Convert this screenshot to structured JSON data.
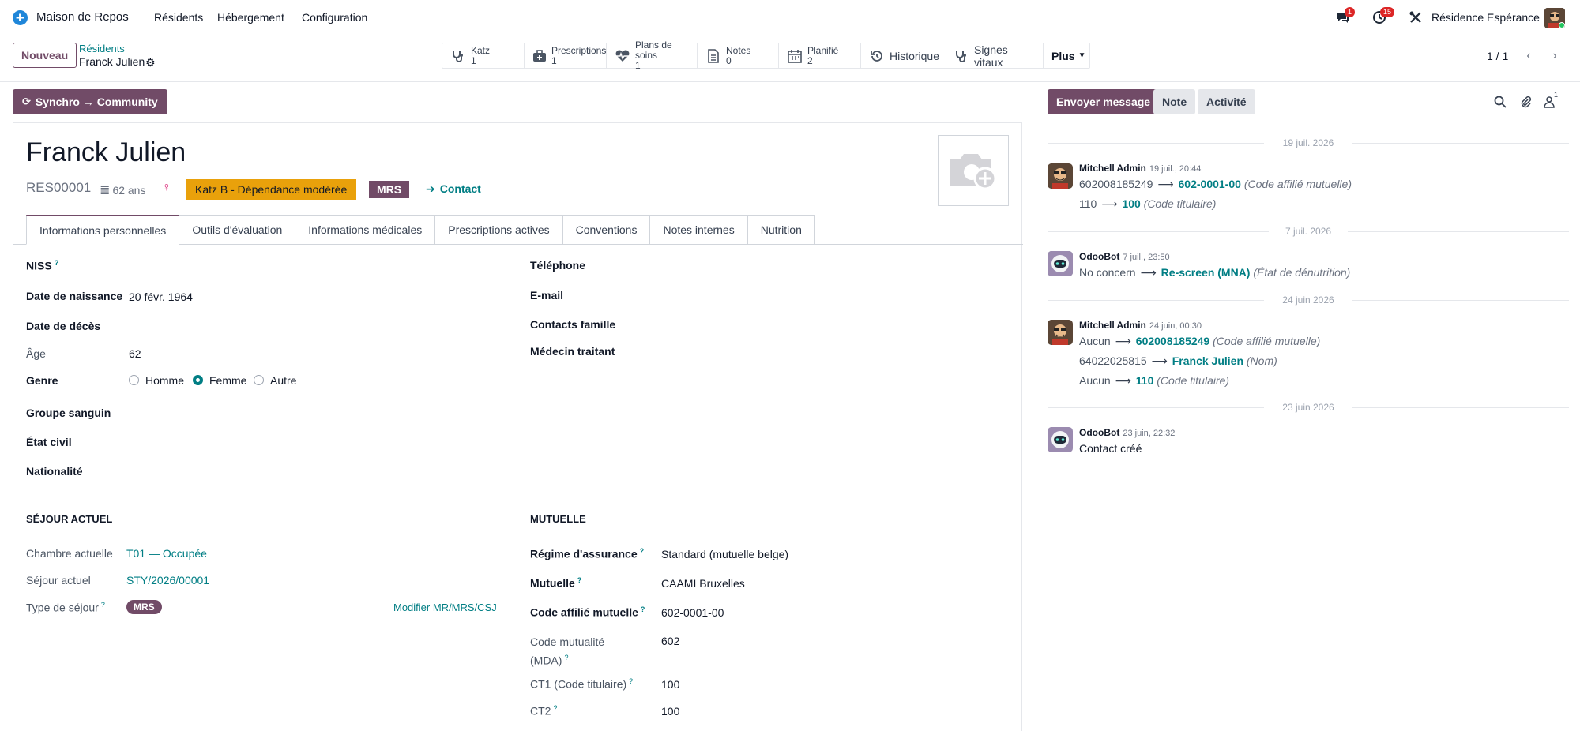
{
  "topnav": {
    "app_name": "Maison de Repos",
    "menu": [
      "Résidents",
      "Hébergement",
      "Configuration"
    ],
    "messages_count": "1",
    "activities_count": "15",
    "company": "Résidence Espérance"
  },
  "control": {
    "new_label": "Nouveau",
    "breadcrumb_parent": "Résidents",
    "breadcrumb_current": "Franck Julien",
    "smart_buttons": [
      {
        "label": "Katz",
        "count": "1",
        "icon": "stethoscope-icon"
      },
      {
        "label": "Prescriptions",
        "count": "1",
        "icon": "medkit-icon"
      },
      {
        "label": "Plans de soins",
        "count": "1",
        "icon": "heartbeat-icon"
      },
      {
        "label": "Notes",
        "count": "0",
        "icon": "file-text-icon"
      },
      {
        "label": "Planifié",
        "count": "2",
        "icon": "calendar-icon"
      },
      {
        "label": "Historique",
        "icon": "history-icon"
      },
      {
        "label": "Signes vitaux",
        "icon": "stethoscope-icon"
      },
      {
        "label": "Plus"
      }
    ],
    "pager": "1 / 1"
  },
  "form": {
    "sync_label": "Synchro → Community",
    "name": "Franck Julien",
    "ref": "RES00001",
    "age_short": "62 ans",
    "katz_tag": "Katz B - Dépendance modérée",
    "type_tag": "MRS",
    "contact_link": "Contact",
    "tabs": [
      "Informations personnelles",
      "Outils d'évaluation",
      "Informations médicales",
      "Prescriptions actives",
      "Conventions",
      "Notes internes",
      "Nutrition"
    ],
    "personal": {
      "niss_label": "NISS",
      "birth_label": "Date de naissance",
      "birth_value": "20 févr. 1964",
      "death_label": "Date de décès",
      "age_label": "Âge",
      "age_value": "62",
      "gender_label": "Genre",
      "gender_options": [
        "Homme",
        "Femme",
        "Autre"
      ],
      "gender_selected": "Femme",
      "blood_label": "Groupe sanguin",
      "civil_label": "État civil",
      "nationality_label": "Nationalité",
      "phone_label": "Téléphone",
      "email_label": "E-mail",
      "family_label": "Contacts famille",
      "doctor_label": "Médecin traitant"
    },
    "stay": {
      "section": "SÉJOUR ACTUEL",
      "room_label": "Chambre actuelle",
      "room_value": "T01 — Occupée",
      "stay_label": "Séjour actuel",
      "stay_value": "STY/2026/00001",
      "type_label": "Type de séjour",
      "type_value": "MRS",
      "modify_link": "Modifier MR/MRS/CSJ"
    },
    "mutuelle": {
      "section": "MUTUELLE",
      "regime_label": "Régime d'assurance",
      "regime_value": "Standard (mutuelle belge)",
      "mutuelle_label": "Mutuelle",
      "mutuelle_value": "CAAMI Bruxelles",
      "affiliate_label": "Code affilié mutuelle",
      "affiliate_value": "602-0001-00",
      "code_label_1": "Code mutualité",
      "code_label_2": "(MDA)",
      "code_value": "602",
      "ct1_label": "CT1 (Code titulaire)",
      "ct1_value": "100",
      "ct2_label": "CT2",
      "ct2_value": "100"
    }
  },
  "chatter": {
    "send_label": "Envoyer message",
    "note_label": "Note",
    "activity_label": "Activité",
    "followers_count": "1",
    "groups": [
      {
        "date": "19 juil. 2026",
        "author": "Mitchell Admin",
        "time": "19 juil., 20:44",
        "lines": [
          {
            "old": "602008185249",
            "new": "602-0001-00",
            "field": "(Code affilié mutuelle)"
          },
          {
            "old": "110",
            "new": "100",
            "field": "(Code titulaire)"
          }
        ]
      },
      {
        "date": "7 juil. 2026",
        "author": "OdooBot",
        "time": "7 juil., 23:50",
        "lines": [
          {
            "old": "No concern",
            "new": "Re-screen (MNA)",
            "field": "(État de dénutrition)"
          }
        ]
      },
      {
        "date": "24 juin 2026",
        "author": "Mitchell Admin",
        "time": "24 juin, 00:30",
        "lines": [
          {
            "old": "Aucun",
            "new": "602008185249",
            "field": "(Code affilié mutuelle)"
          },
          {
            "old": "64022025815",
            "new": "Franck Julien",
            "field": "(Nom)"
          },
          {
            "old": "Aucun",
            "new": "110",
            "field": "(Code titulaire)"
          }
        ]
      },
      {
        "date": "23 juin 2026",
        "author": "OdooBot",
        "time": "23 juin, 22:32",
        "text": "Contact créé"
      }
    ]
  },
  "colors": {
    "brand": "#714b67",
    "link": "#017e84",
    "katz": "#e9a10b"
  }
}
